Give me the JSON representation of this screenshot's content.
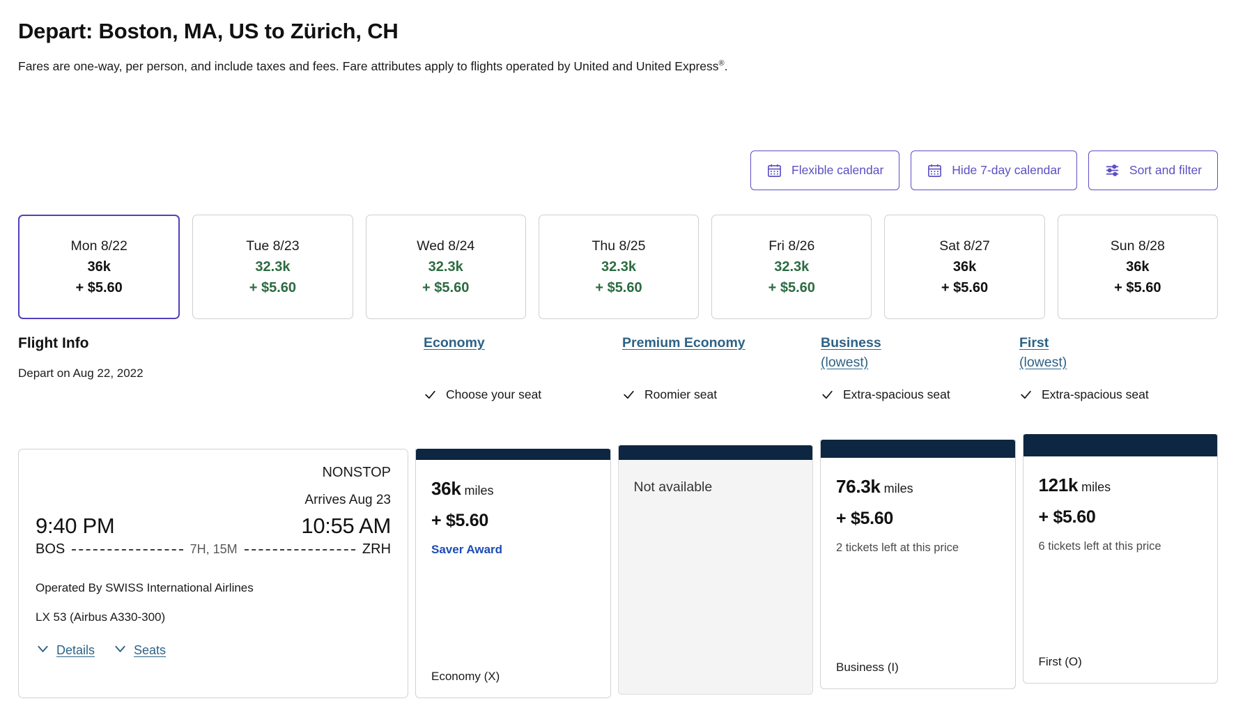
{
  "header": {
    "title": "Depart: Boston, MA, US to Zürich, CH",
    "subtitle_pre": "Fares are one-way, per person, and include taxes and fees. Fare attributes apply to flights operated by United and United Express",
    "subtitle_sup": "®",
    "subtitle_post": "."
  },
  "toolbar": {
    "flexible_calendar": "Flexible calendar",
    "hide_7day_calendar": "Hide 7-day calendar",
    "sort_and_filter": "Sort and filter",
    "accent_color": "#5b4fc4",
    "icons": [
      "calendar-icon",
      "calendar-icon",
      "sliders-icon"
    ]
  },
  "date_strip": [
    {
      "day": "Mon 8/22",
      "miles": "36k",
      "fee": "+ $5.60",
      "selected": true,
      "cheapest": false
    },
    {
      "day": "Tue 8/23",
      "miles": "32.3k",
      "fee": "+ $5.60",
      "selected": false,
      "cheapest": true
    },
    {
      "day": "Wed 8/24",
      "miles": "32.3k",
      "fee": "+ $5.60",
      "selected": false,
      "cheapest": true
    },
    {
      "day": "Thu 8/25",
      "miles": "32.3k",
      "fee": "+ $5.60",
      "selected": false,
      "cheapest": true
    },
    {
      "day": "Fri 8/26",
      "miles": "32.3k",
      "fee": "+ $5.60",
      "selected": false,
      "cheapest": true
    },
    {
      "day": "Sat 8/27",
      "miles": "36k",
      "fee": "+ $5.60",
      "selected": false,
      "cheapest": false
    },
    {
      "day": "Sun 8/28",
      "miles": "36k",
      "fee": "+ $5.60",
      "selected": false,
      "cheapest": false
    }
  ],
  "columns": {
    "flight_info_heading": "Flight Info",
    "depart_on": "Depart on Aug 22, 2022",
    "cabins": [
      {
        "name": "Economy",
        "lowest": "",
        "attribute": "Choose your seat"
      },
      {
        "name": "Premium Economy",
        "lowest": "",
        "attribute": "Roomier seat"
      },
      {
        "name": "Business",
        "lowest": "(lowest)",
        "attribute": "Extra-spacious seat"
      },
      {
        "name": "First",
        "lowest": "(lowest)",
        "attribute": "Extra-spacious seat"
      }
    ]
  },
  "flight": {
    "nonstop": "NONSTOP",
    "arrives": "Arrives Aug 23",
    "depart_time": "9:40 PM",
    "arrive_time": "10:55 AM",
    "origin": "BOS",
    "destination": "ZRH",
    "duration": "7H, 15M",
    "operated_by": "Operated By SWISS International Airlines",
    "equipment": "LX 53 (Airbus A330-300)",
    "details_link": "Details",
    "seats_link": "Seats"
  },
  "fares": [
    {
      "available": true,
      "miles": "36k",
      "miles_unit": "miles",
      "fee": "+ $5.60",
      "note": "Saver Award",
      "note_type": "saver",
      "booking_class": "Economy (X)"
    },
    {
      "available": false,
      "unavailable_text": "Not available",
      "booking_class": ""
    },
    {
      "available": true,
      "miles": "76.3k",
      "miles_unit": "miles",
      "fee": "+ $5.60",
      "note": "2 tickets left at this price",
      "note_type": "left",
      "booking_class": "Business (I)"
    },
    {
      "available": true,
      "miles": "121k",
      "miles_unit": "miles",
      "fee": "+ $5.60",
      "note": "6 tickets left at this price",
      "note_type": "left",
      "booking_class": "First (O)"
    }
  ],
  "colors": {
    "purple": "#5b4fc4",
    "selected_border": "#5140bd",
    "green": "#2c6b41",
    "teal_link": "#2d6286",
    "saver_blue": "#1b4bb5",
    "navy_bar": "#0d2642"
  }
}
